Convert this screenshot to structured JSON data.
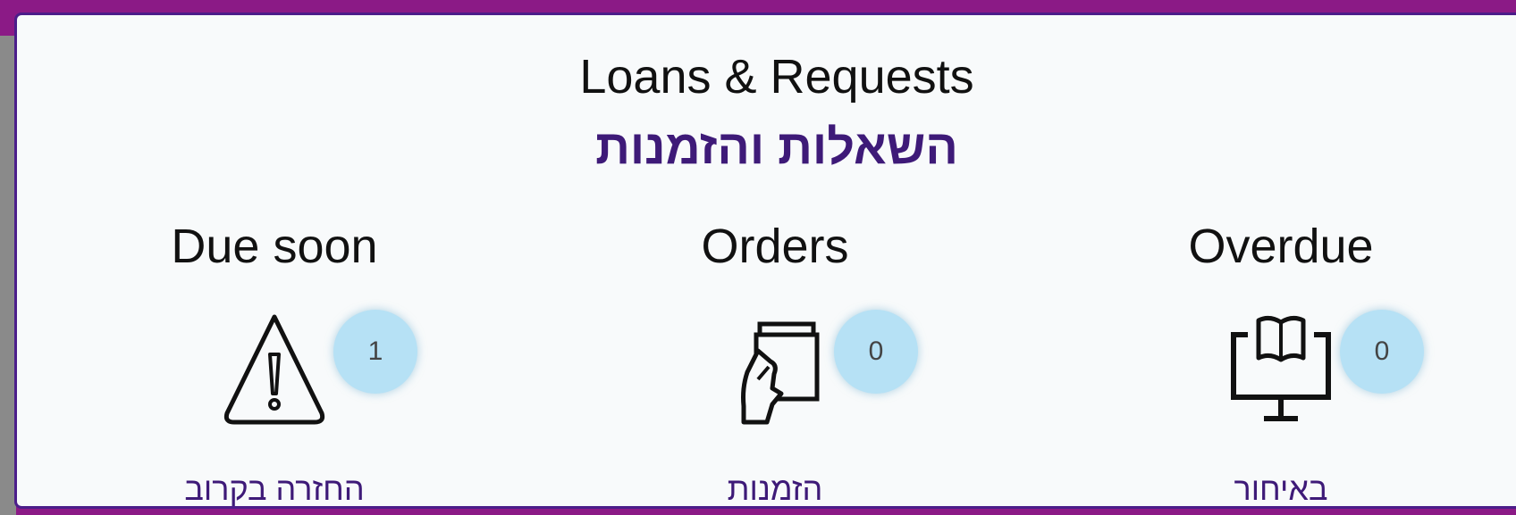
{
  "widget": {
    "title_en": "Loans & Requests",
    "title_he": "השאלות והזמנות"
  },
  "tiles": [
    {
      "label_en": "Due soon",
      "count": "1",
      "label_he": "החזרה בקרוב",
      "icon": "warning-triangle-icon"
    },
    {
      "label_en": "Orders",
      "count": "0",
      "label_he": "הזמנות",
      "icon": "hand-holding-book-icon"
    },
    {
      "label_en": "Overdue",
      "count": "0",
      "label_he": "באיחור",
      "icon": "book-monitor-icon"
    }
  ],
  "colors": {
    "frame": "#8b1a86",
    "card_border": "#4b1d8a",
    "hebrew_text": "#3e1a78",
    "badge": "#b6e1f5"
  }
}
